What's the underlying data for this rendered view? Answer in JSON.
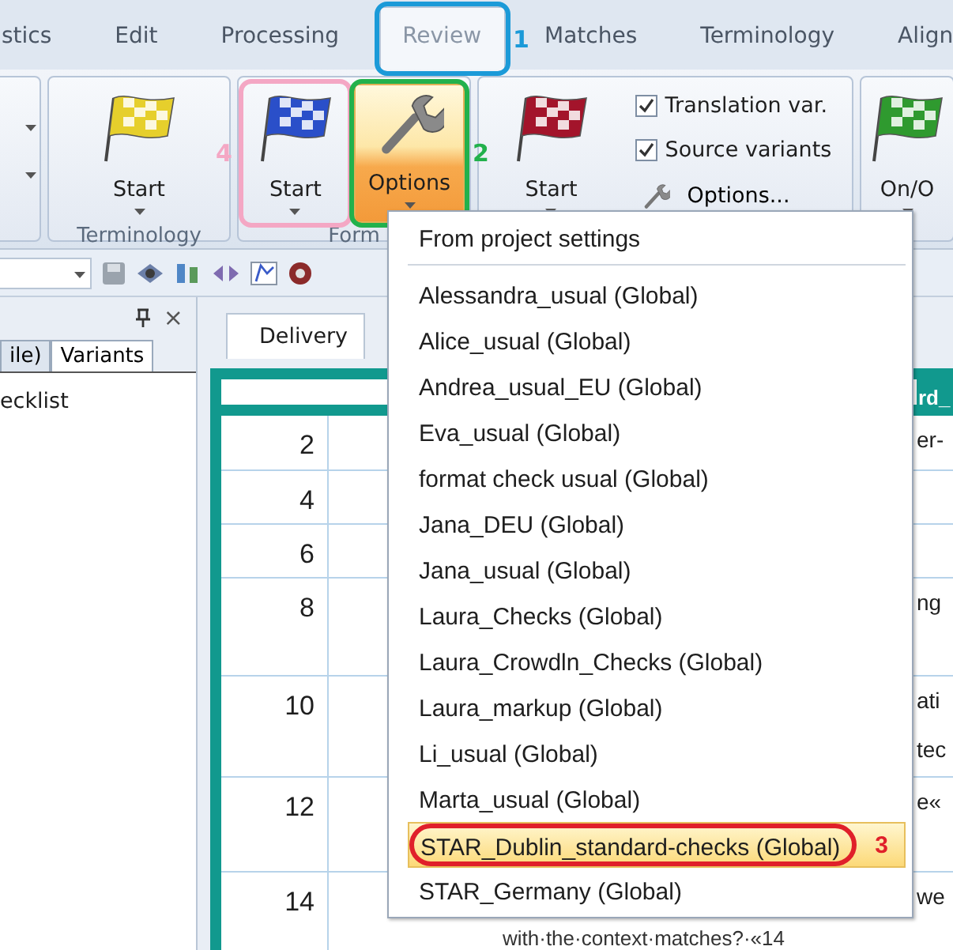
{
  "ribbon_tabs": [
    {
      "label": "stics",
      "selected": false
    },
    {
      "label": "Edit",
      "selected": false
    },
    {
      "label": "Processing",
      "selected": false
    },
    {
      "label": "Review",
      "selected": true,
      "annotation": {
        "label": "1",
        "color": "#1b9ad8"
      }
    },
    {
      "label": "Matches",
      "selected": false
    },
    {
      "label": "Terminology",
      "selected": false
    },
    {
      "label": "Align",
      "selected": false
    }
  ],
  "ribbon_groups": [
    {
      "items": [
        {
          "kind": "carets"
        }
      ]
    },
    {
      "label": "Terminology",
      "items": [
        {
          "kind": "flag",
          "label": "Start",
          "color": "#e6cf2c",
          "selected": false
        }
      ]
    },
    {
      "label": "Form",
      "items": [
        {
          "kind": "flag",
          "label": "Start",
          "color": "#2a4fc9",
          "selected": false,
          "annotation": {
            "label": "4",
            "color": "#f4a7c4"
          }
        },
        {
          "kind": "wrench",
          "label": "Options",
          "selected": true,
          "annotation": {
            "label": "2",
            "color": "#22b14c"
          }
        }
      ]
    },
    {
      "items": [
        {
          "kind": "flag",
          "label": "Start",
          "color": "#a3142b",
          "selected": false
        },
        {
          "kind": "options",
          "checks": [
            {
              "label": "Translation var.",
              "checked": true
            },
            {
              "label": "Source variants",
              "checked": true
            }
          ],
          "link": "Options..."
        }
      ]
    },
    {
      "items": [
        {
          "kind": "flag",
          "label": "On/O",
          "color": "#2f9a2f",
          "selected": false
        }
      ]
    }
  ],
  "left_pane": {
    "close": "×",
    "tabs": [
      {
        "label": "ile)",
        "selected": false
      },
      {
        "label": "Variants",
        "selected": true
      }
    ],
    "text": "ecklist"
  },
  "editor": {
    "tab": "Delivery",
    "header": "rd_",
    "rows": [
      {
        "number": "2",
        "lines": [
          {
            "kind": "fragment",
            "text": "er-"
          }
        ]
      },
      {
        "number": "4",
        "lines": []
      },
      {
        "number": "6",
        "lines": []
      },
      {
        "number": "8",
        "lines": [
          {
            "kind": "fragment",
            "text": "ng"
          }
        ]
      },
      {
        "number": "10",
        "lines": [
          {
            "kind": "fragment",
            "text": "ati"
          },
          {
            "kind": "fragment",
            "text": "tec"
          }
        ]
      },
      {
        "number": "12",
        "lines": [
          {
            "kind": "fragment",
            "text": "e«"
          }
        ]
      },
      {
        "number": "14",
        "lines": [
          {
            "kind": "fragment",
            "text": "we"
          },
          {
            "kind": "line",
            "text": "with·the·context·matches?·«14"
          }
        ]
      }
    ]
  },
  "menu": {
    "items": [
      {
        "text": "From project settings",
        "selected": false
      },
      {
        "text": "Alessandra_usual (Global)",
        "selected": false
      },
      {
        "text": "Alice_usual (Global)",
        "selected": false
      },
      {
        "text": "Andrea_usual_EU (Global)",
        "selected": false
      },
      {
        "text": "Eva_usual (Global)",
        "selected": false
      },
      {
        "text": "format check usual (Global)",
        "selected": false
      },
      {
        "text": "Jana_DEU (Global)",
        "selected": false
      },
      {
        "text": "Jana_usual (Global)",
        "selected": false
      },
      {
        "text": "Laura_Checks (Global)",
        "selected": false
      },
      {
        "text": "Laura_Crowdln_Checks (Global)",
        "selected": false
      },
      {
        "text": "Laura_markup (Global)",
        "selected": false
      },
      {
        "text": "Li_usual (Global)",
        "selected": false
      },
      {
        "text": "Marta_usual (Global)",
        "selected": false
      },
      {
        "text": "STAR_Dublin_standard-checks (Global)",
        "selected": true,
        "annotation": {
          "label": "3",
          "color": "#e0202a"
        }
      },
      {
        "text": "STAR_Germany (Global)",
        "selected": false
      }
    ]
  }
}
